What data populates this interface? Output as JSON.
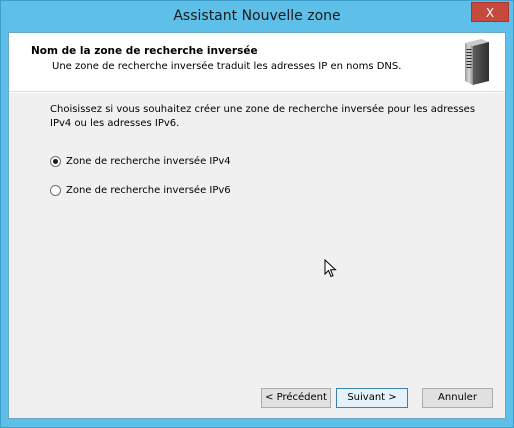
{
  "window": {
    "title": "Assistant Nouvelle zone",
    "close_label": "X"
  },
  "header": {
    "title": "Nom de la zone de recherche inversée",
    "subtitle": "Une zone de recherche inversée traduit les adresses IP en noms DNS.",
    "icon": "server-icon"
  },
  "body": {
    "intro": "Choisissez si vous souhaitez créer une zone de recherche inversée pour les adresses IPv4 ou les adresses IPv6.",
    "options": [
      {
        "label": "Zone de recherche inversée IPv4",
        "selected": true
      },
      {
        "label": "Zone de recherche inversée IPv6",
        "selected": false
      }
    ]
  },
  "buttons": {
    "back": "< Précédent",
    "next": "Suivant >",
    "cancel": "Annuler"
  },
  "colors": {
    "chrome": "#5ec0e8",
    "close": "#c7483c",
    "client": "#f0f0f0"
  }
}
